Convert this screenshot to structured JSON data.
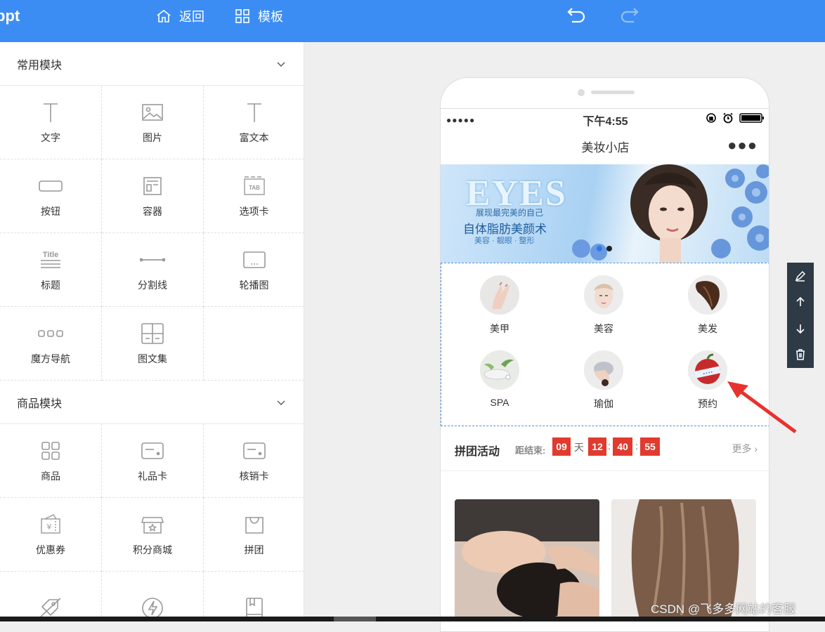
{
  "app": {
    "brand": "ppt",
    "back_label": "返回",
    "template_label": "模板",
    "accent": "#3c8df3"
  },
  "sidebar": {
    "common_title": "常用模块",
    "common_items": [
      {
        "label": "文字",
        "icon": "text-icon"
      },
      {
        "label": "图片",
        "icon": "image-icon"
      },
      {
        "label": "富文本",
        "icon": "rich-text-icon"
      },
      {
        "label": "按钮",
        "icon": "button-icon"
      },
      {
        "label": "容器",
        "icon": "container-icon"
      },
      {
        "label": "选项卡",
        "icon": "tab-icon"
      },
      {
        "label": "标题",
        "icon": "title-icon"
      },
      {
        "label": "分割线",
        "icon": "divider-icon"
      },
      {
        "label": "轮播图",
        "icon": "carousel-icon"
      },
      {
        "label": "魔方导航",
        "icon": "cube-nav-icon"
      },
      {
        "label": "图文集",
        "icon": "gallery-icon"
      }
    ],
    "goods_title": "商品模块",
    "goods_items": [
      {
        "label": "商品",
        "icon": "product-icon"
      },
      {
        "label": "礼品卡",
        "icon": "gift-card-icon"
      },
      {
        "label": "核销卡",
        "icon": "redeem-card-icon"
      },
      {
        "label": "优惠券",
        "icon": "coupon-icon"
      },
      {
        "label": "积分商城",
        "icon": "points-store-icon"
      },
      {
        "label": "拼团",
        "icon": "group-buy-icon"
      }
    ]
  },
  "phone": {
    "status_time": "下午4:55",
    "shop_title": "美妆小店",
    "banner": {
      "eyes": "EYES",
      "line1": "展现最完美的自己",
      "line2": "自体脂肪美颜术",
      "line3": "美容 · 靓眼 · 整形"
    },
    "categories": [
      "美甲",
      "美容",
      "美发",
      "SPA",
      "瑜伽",
      "预约"
    ],
    "group": {
      "title": "拼团活动",
      "ends": "距结束:",
      "days": "09",
      "day_unit": "天",
      "hours": "12",
      "minutes": "40",
      "seconds": "55",
      "colon": ":",
      "more": "更多"
    }
  },
  "watermark": "CSDN @飞多多网站的客服"
}
